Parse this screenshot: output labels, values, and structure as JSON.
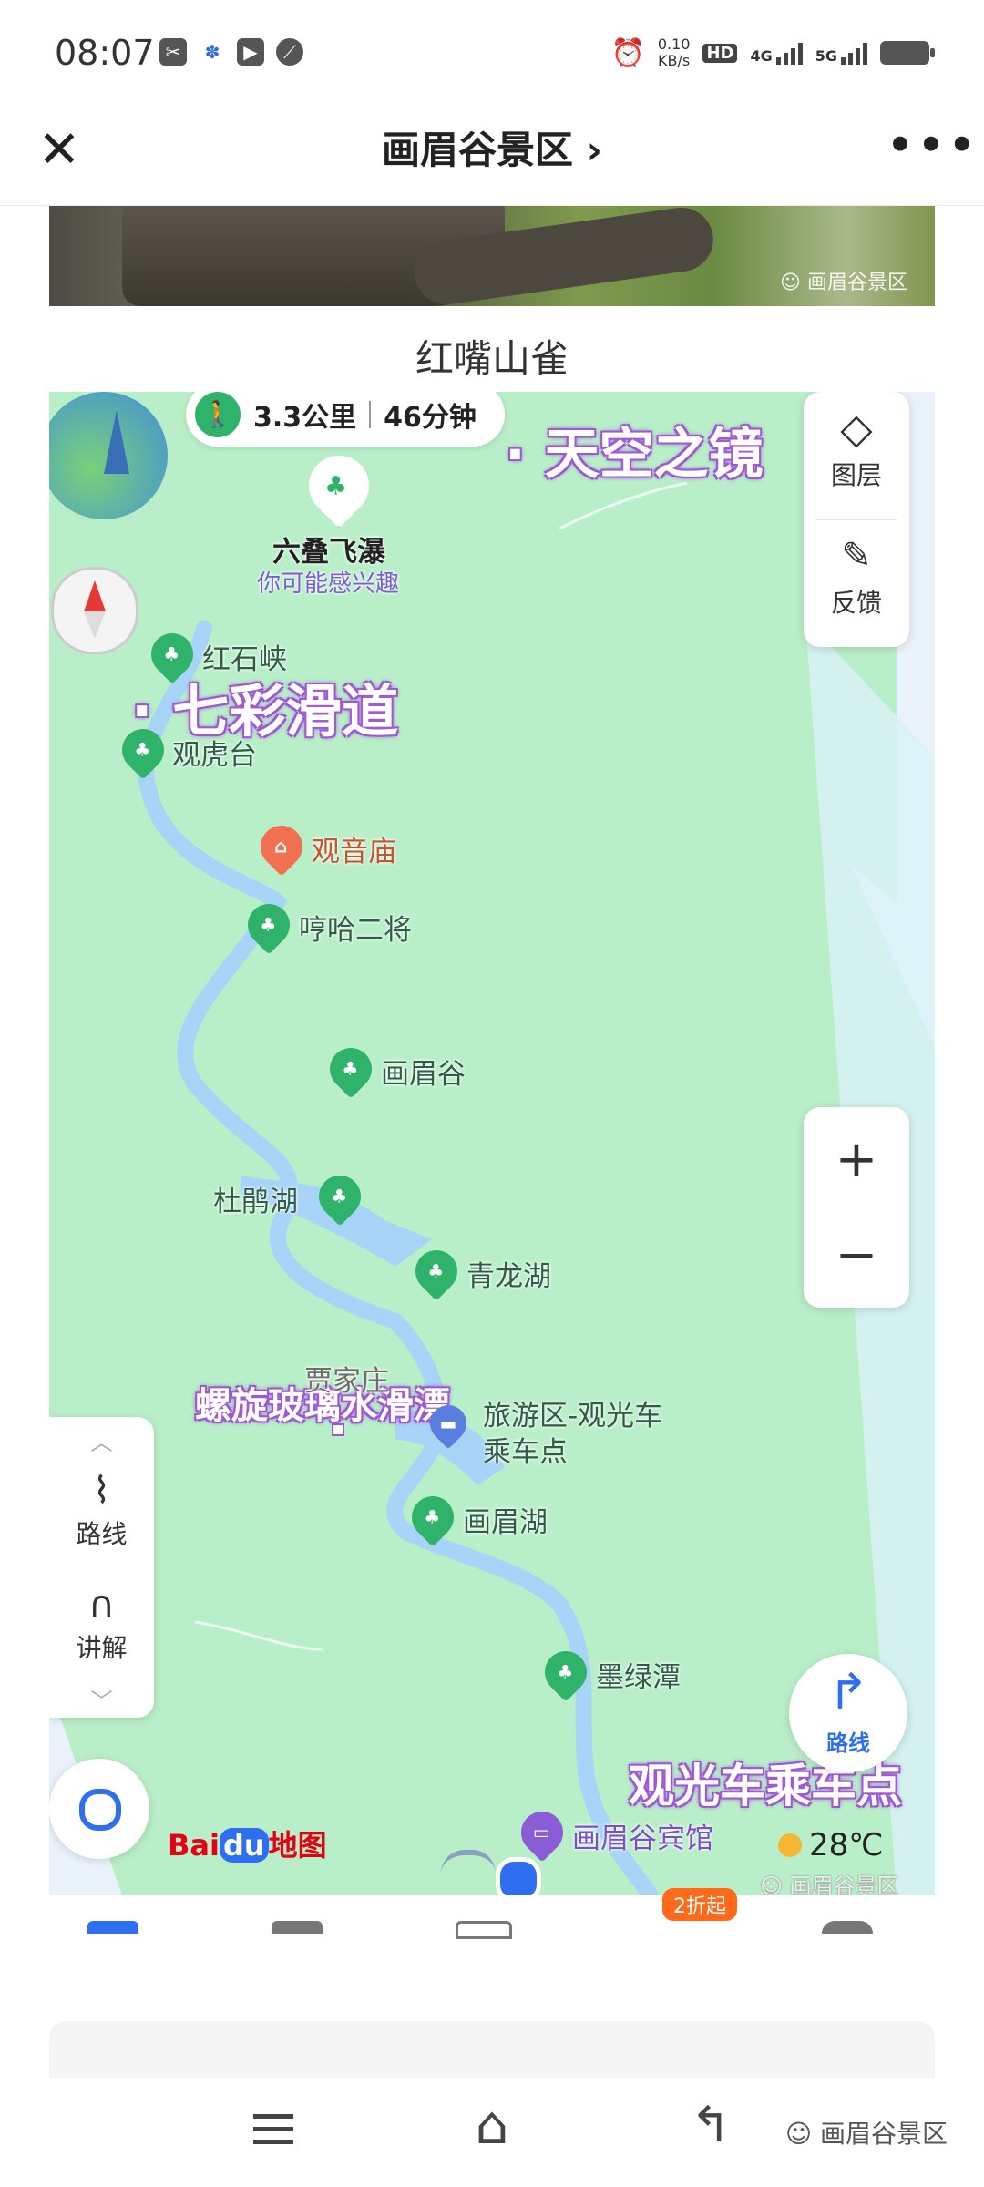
{
  "status_bar": {
    "time": "08:07",
    "net_speed": "0.10\nKB/s",
    "net_speed_top": "0.10",
    "net_speed_bottom": "KB/s",
    "hd": "HD",
    "sim1": "1",
    "sim2": "2",
    "net1": "4G",
    "net2": "5G"
  },
  "header": {
    "close_icon": "close-icon",
    "title": "画眉谷景区 ›",
    "more_icon": "more-icon"
  },
  "photo": {
    "watermark": "画眉谷景区"
  },
  "caption": "红嘴山雀",
  "map": {
    "walk_distance": "3.3公里",
    "walk_time": "46分钟",
    "pois": {
      "liudie": "六叠飞瀑",
      "liudie_sub": "你可能感兴趣",
      "hongshixia": "红石峡",
      "guanhutai": "观虎台",
      "guanyinmiao": "观音庙",
      "henghaerjiang": "哼哈二将",
      "huameigu": "画眉谷",
      "dujuanhu": "杜鹃湖",
      "qinglonghu": "青龙湖",
      "jiajiazhuang": "贾家庄",
      "lvyouqu": "旅游区-观光车",
      "lvyouqu2": "乘车点",
      "huameihu": "画眉湖",
      "molvtan": "墨绿潭",
      "binguan": "画眉谷宾馆"
    },
    "highlights": {
      "tiankong": "· 天空之镜",
      "qicai": "· 七彩滑道",
      "luoxuan": "螺旋玻璃水滑漂",
      "guangguang": "观光车乘车点"
    },
    "controls": {
      "layers": "图层",
      "feedback": "反馈",
      "zoom_in": "+",
      "zoom_out": "−",
      "route": "路线",
      "guide": "讲解",
      "route_fab": "路线"
    },
    "brand": {
      "bai": "Bai",
      "du": "du",
      "ditu": "地图"
    },
    "weather": "28℃",
    "watermark": "画眉谷景区"
  },
  "tabbar": {
    "discount": "2折起"
  },
  "navbar": {
    "watermark": "画眉谷景区"
  },
  "colors": {
    "park_green": "#b9efc8",
    "water": "#a8d4f7",
    "poi_green": "#2fb36b",
    "accent_purple": "#9b55cf",
    "temple_orange": "#f07050"
  }
}
